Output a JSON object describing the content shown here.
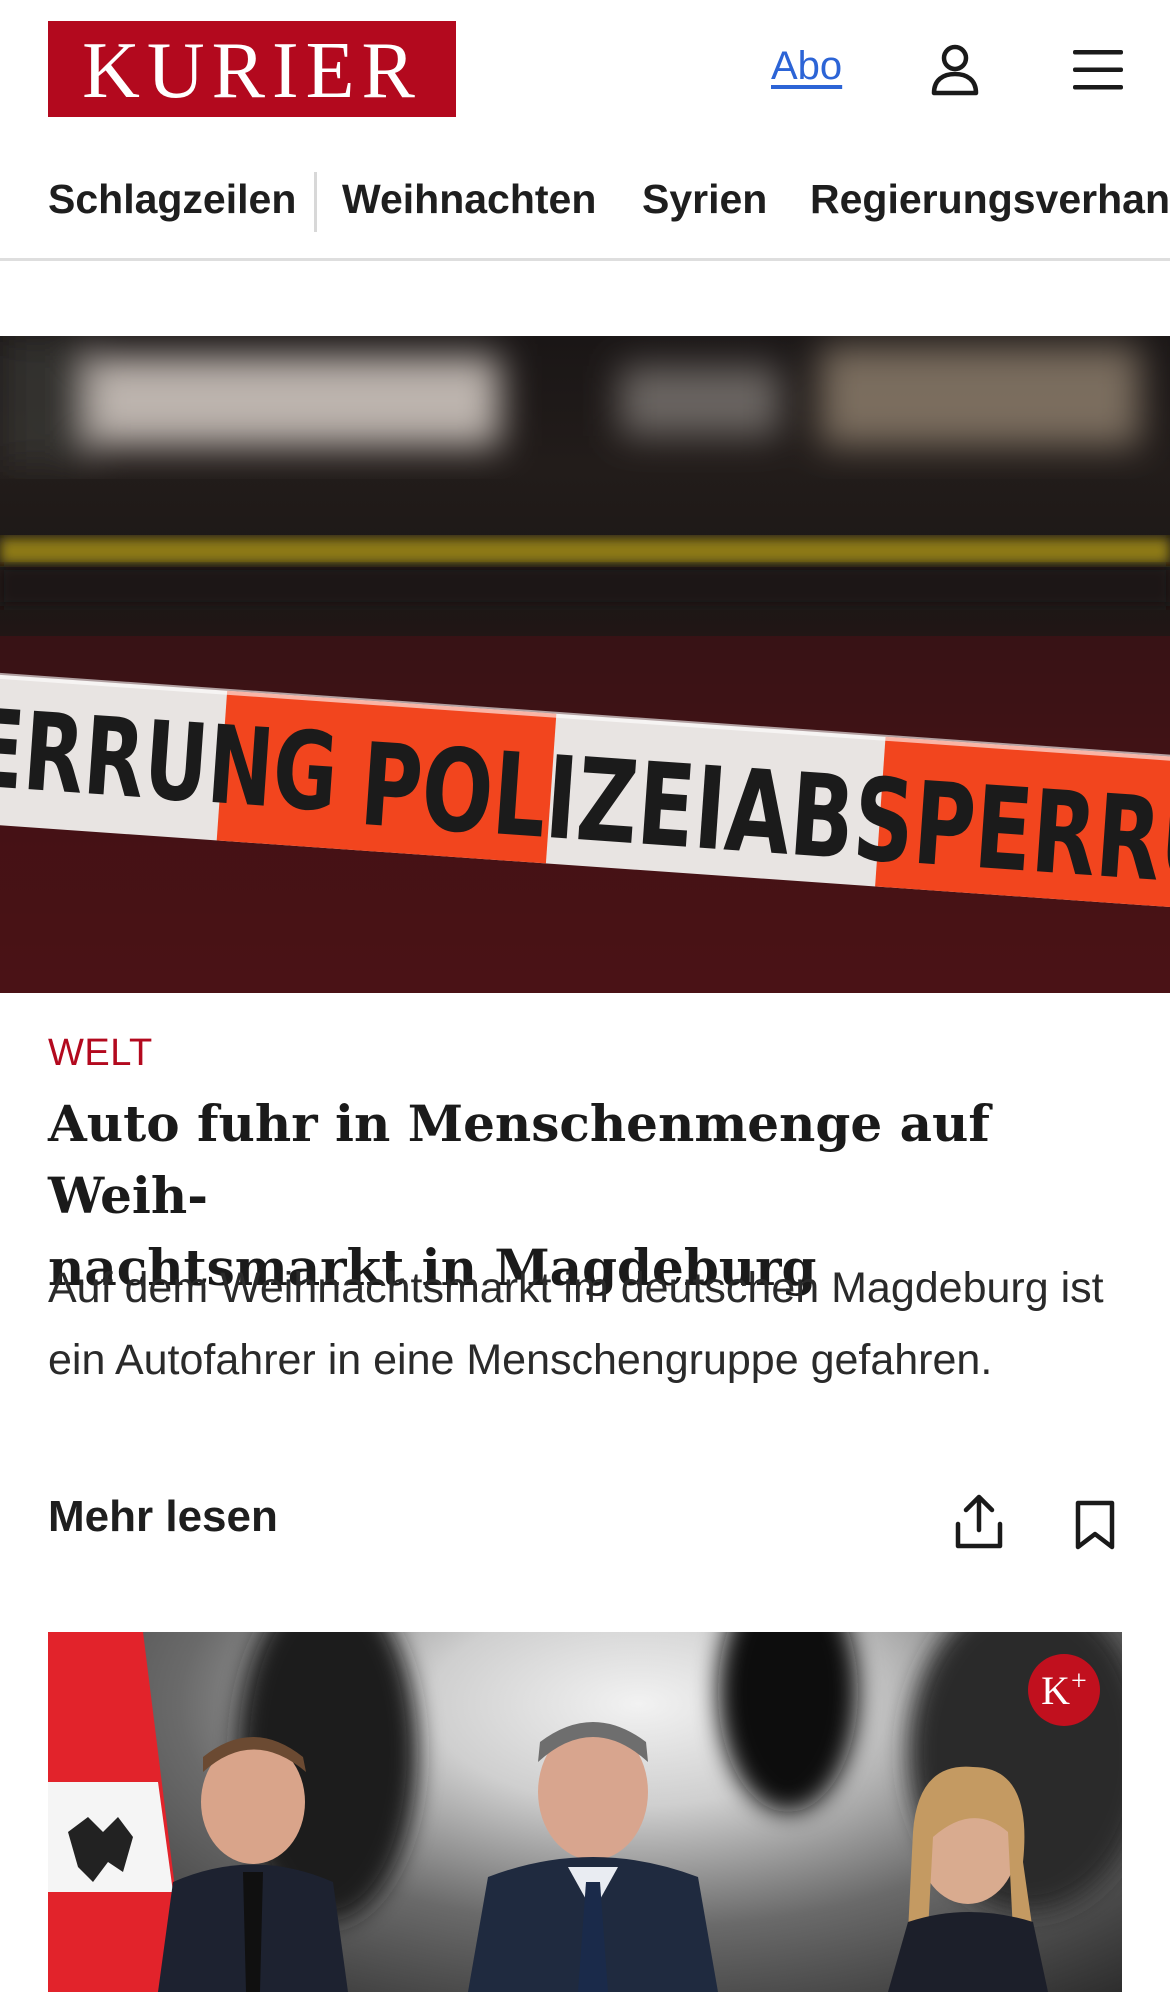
{
  "header": {
    "logo_text": "KURIER",
    "abo_label": "Abo",
    "icons": [
      "user-icon",
      "menu-icon"
    ]
  },
  "nav": {
    "items": [
      "Schlagzeilen",
      "Weihnachten",
      "Syrien",
      "Regierungsverhand"
    ]
  },
  "hero": {
    "image_text": [
      "ERRUNG",
      "POLIZEIABSPERRUNG"
    ]
  },
  "article": {
    "category": "WELT",
    "headline_line1": "Auto fuhr in Menschenmenge auf Weih-",
    "headline_line2": "nachtsmarkt in Magdeburg",
    "teaser": "Auf dem Weihnachtsmarkt im deutschen Magdeburg ist ein Autofahrer in eine Menschengruppe gefahren.",
    "more_label": "Mehr lesen",
    "icons": [
      "share-icon",
      "bookmark-icon"
    ]
  },
  "second_teaser": {
    "badge_text": "K",
    "badge_sup": "+"
  },
  "colors": {
    "brand_red": "#b3091e",
    "link_blue": "#2c64d6",
    "text": "#1a1a1a"
  }
}
